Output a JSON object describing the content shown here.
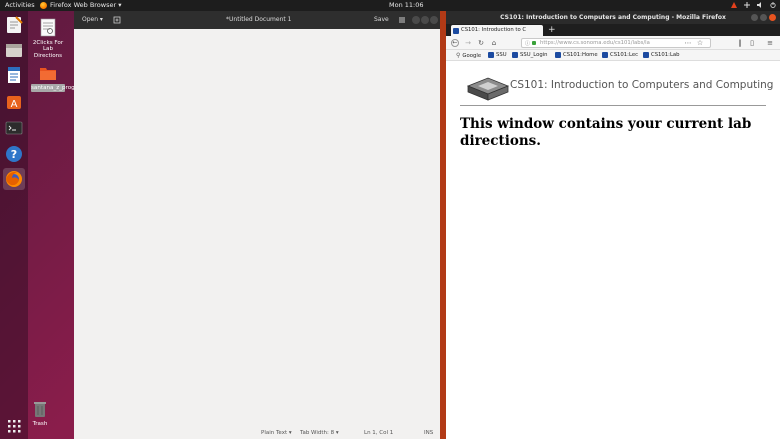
{
  "top_bar": {
    "activities": "Activities",
    "app_menu": "Firefox Web Browser ▾",
    "clock": "Mon 11:06"
  },
  "desktop": {
    "icons": [
      {
        "label": "2Clicks For Lab Directions"
      },
      {
        "label": "santana_z_prog2"
      }
    ],
    "trash": "Trash"
  },
  "gedit": {
    "open": "Open ▾",
    "title": "*Untitled Document 1",
    "save": "Save",
    "status": {
      "language": "Plain Text ▾",
      "tab_width": "Tab Width: 8 ▾",
      "position": "Ln 1, Col 1",
      "mode": "INS"
    }
  },
  "firefox": {
    "window_title": "CS101: Introduction to Computers and Computing - Mozilla Firefox",
    "tab_title": "CS101: Introduction to C",
    "new_tab": "+",
    "url": "https://www.cs.sonoma.edu/cs101/labs/la",
    "bookmarks": [
      "Google",
      "SSU",
      "SSU_Login",
      "CS101:Home",
      "CS101:Lec",
      "CS101:Lab"
    ],
    "page": {
      "header_title": "CS101: Introduction to Computers and Computing",
      "heading": "This window contains your current lab directions."
    }
  },
  "colors": {
    "desktop_bg": "#8a1d4b",
    "panel": "#1d1d1d",
    "firefox_accent": "#b23a16"
  }
}
